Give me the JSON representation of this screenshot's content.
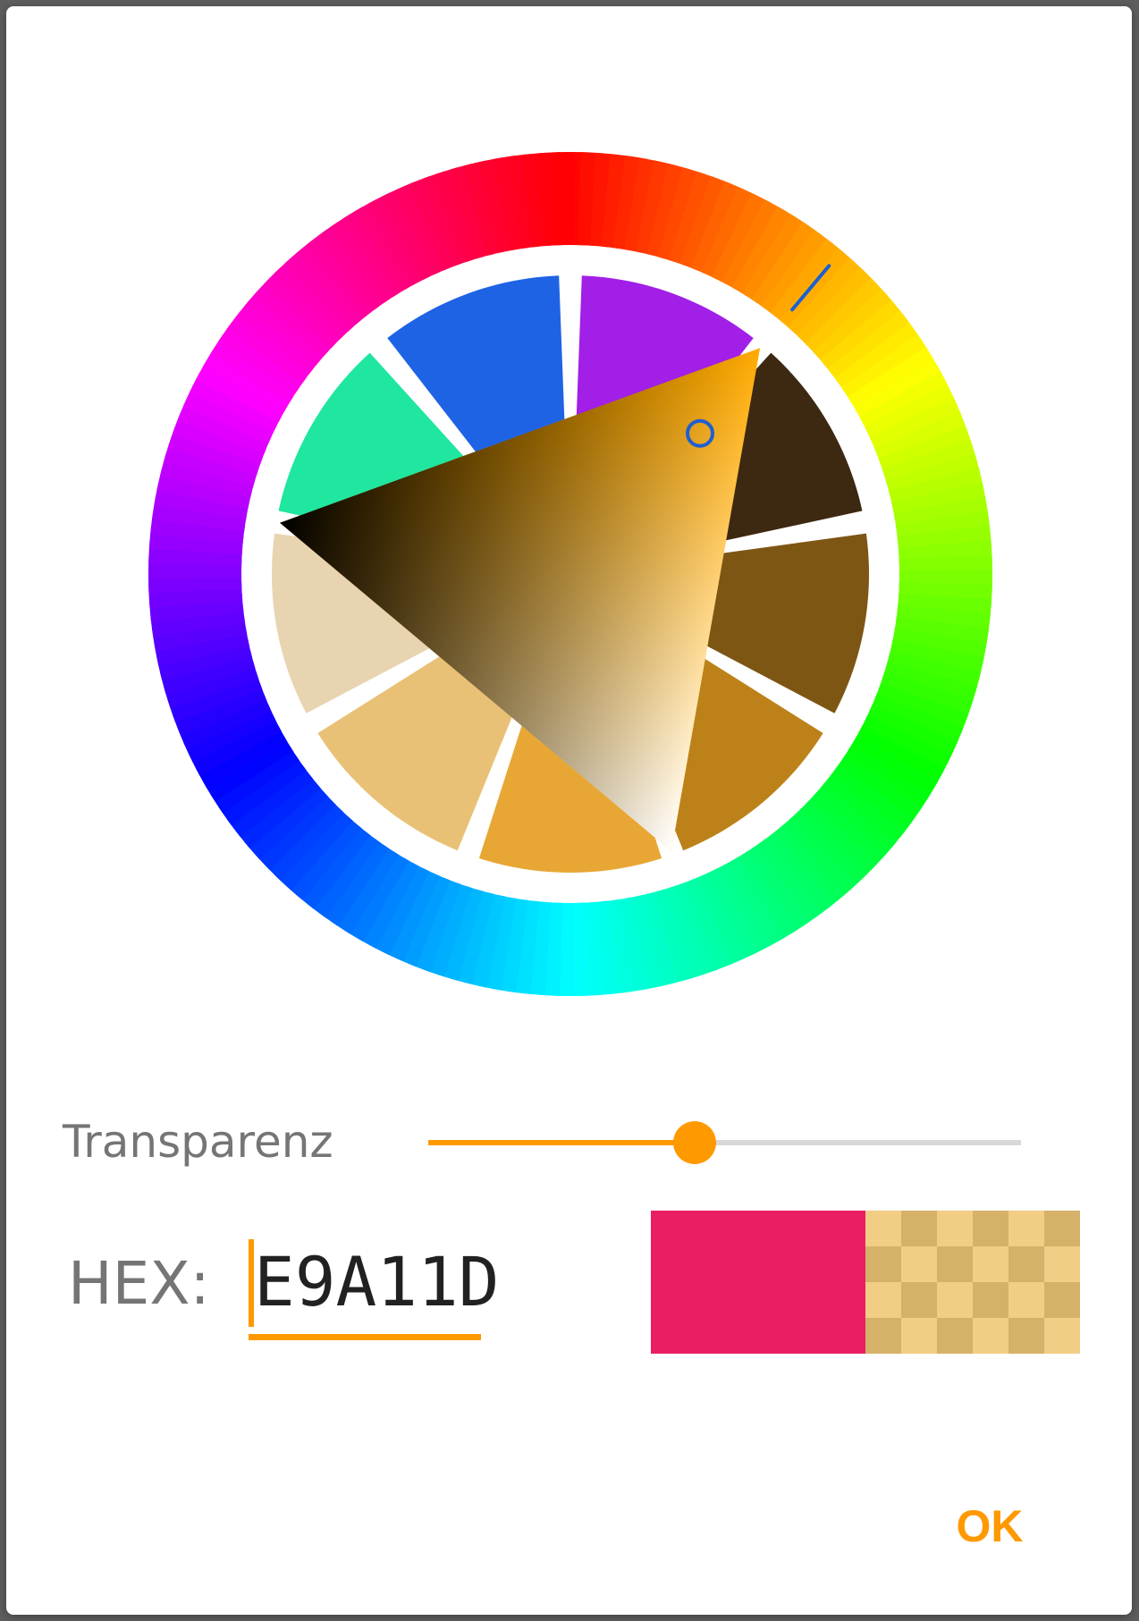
{
  "picker": {
    "hue_degrees": 40,
    "accent_color": "#ff9900",
    "marker_color": "#1e5fd0",
    "selected_saturation_level": 0.85,
    "selected_value_level": 0.9,
    "swatches": [
      {
        "name": "dark-brown",
        "color": "#3d2812"
      },
      {
        "name": "brown",
        "color": "#7d5614"
      },
      {
        "name": "ochre",
        "color": "#bc8219"
      },
      {
        "name": "light-orange",
        "color": "#e8a735"
      },
      {
        "name": "tan",
        "color": "#e9c176"
      },
      {
        "name": "beige",
        "color": "#e8d4b0"
      },
      {
        "name": "mint",
        "color": "#1fe79f"
      },
      {
        "name": "blue",
        "color": "#1f63e5"
      },
      {
        "name": "purple",
        "color": "#a11fe7"
      }
    ]
  },
  "transparency": {
    "label": "Transparenz",
    "level": 0.45
  },
  "hex": {
    "label": "HEX:",
    "value": "E9A11D"
  },
  "preview": {
    "old_color": "#ea1e63",
    "new_color": "#e9a11d"
  },
  "actions": {
    "ok_label": "OK"
  }
}
